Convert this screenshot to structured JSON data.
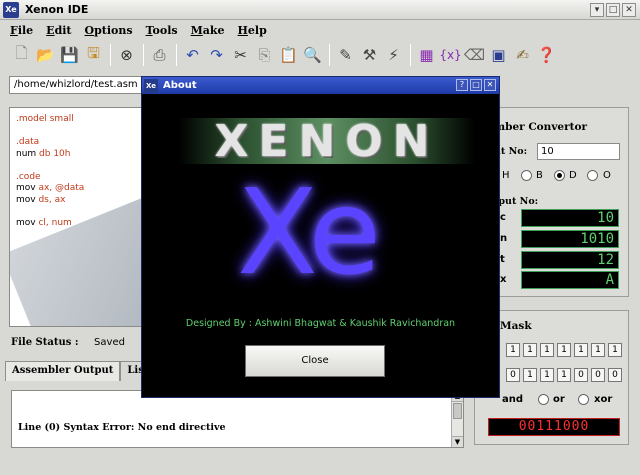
{
  "window": {
    "title": "Xenon IDE",
    "app_icon": "Xe"
  },
  "menu": [
    "File",
    "Edit",
    "Options",
    "Tools",
    "Make",
    "Help"
  ],
  "toolbar_icons": [
    "new-file-icon",
    "open-folder-icon",
    "save-icon",
    "save-all-icon",
    "stop-icon",
    "print-icon",
    "undo-icon",
    "redo-icon",
    "cut-icon",
    "copy-icon",
    "paste-icon",
    "find-icon",
    "assemble-icon",
    "build-icon",
    "link-icon",
    "grid-icon",
    "function-icon",
    "eraser-icon",
    "calculator-icon",
    "notes-icon",
    "help-icon"
  ],
  "path": "/home/whizlord/test.asm",
  "editor": {
    "lines": [
      {
        "a": ".model small",
        "b": ""
      },
      {
        "a": "",
        "b": ""
      },
      {
        "a": ".data",
        "b": ""
      },
      {
        "a": "num ",
        "b": "db 10h"
      },
      {
        "a": "",
        "b": ""
      },
      {
        "a": ".code",
        "b": ""
      },
      {
        "a": "mov ",
        "b": "ax, @data"
      },
      {
        "a": "mov ",
        "b": "ds, ax"
      },
      {
        "a": "",
        "b": ""
      },
      {
        "a": "mov ",
        "b": "cl, num"
      }
    ]
  },
  "file_status": {
    "label": "File Status :",
    "value": "Saved"
  },
  "tabs": [
    "Assembler Output",
    "List File"
  ],
  "output_message": "Line (0) Syntax Error: No end directive",
  "converter": {
    "title": "mber Convertor",
    "input_label": "ut No:",
    "input_value": "10",
    "radios": [
      {
        "label": "H",
        "on": false
      },
      {
        "label": "B",
        "on": false
      },
      {
        "label": "D",
        "on": true
      },
      {
        "label": "O",
        "on": false
      }
    ],
    "output_label": "tput No:",
    "rows": [
      {
        "label": "c",
        "value": "10"
      },
      {
        "label": "n",
        "value": "1010"
      },
      {
        "label": "t",
        "value": "12"
      },
      {
        "label": "x",
        "value": "A"
      }
    ]
  },
  "mask": {
    "title": "Mask",
    "bits_row1": [
      "1",
      "1",
      "1",
      "1",
      "1",
      "1",
      "1"
    ],
    "bits_row2": [
      "0",
      "1",
      "1",
      "1",
      "0",
      "0",
      "0"
    ],
    "ops": [
      "and",
      "or",
      "xor"
    ],
    "result": "00111000"
  },
  "about": {
    "title": "About",
    "logo_text": "XENON",
    "big_text": "Xe",
    "designed_by": "Designed By : Ashwini Bhagwat & Kaushik Ravichandran",
    "close_label": "Close"
  }
}
